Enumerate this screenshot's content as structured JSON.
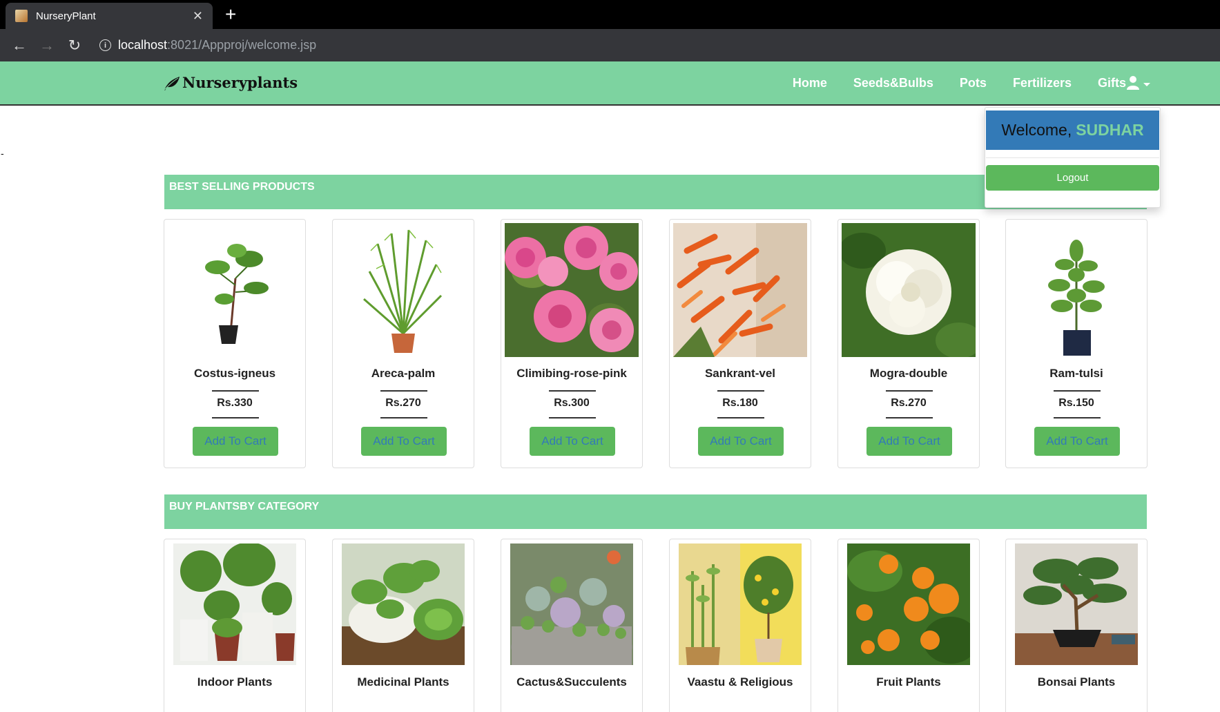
{
  "browser": {
    "tab_title": "NurseryPlant",
    "url_host": "localhost",
    "url_rest": ":8021/Appproj/welcome.jsp"
  },
  "site": {
    "brand": "Nurseryplants",
    "nav": [
      "Home",
      "Seeds&Bulbs",
      "Pots",
      "Fertilizers",
      "Gifts"
    ]
  },
  "user_menu": {
    "welcome_prefix": "Welcome,",
    "user_name": "SUDHAR",
    "logout": "Logout"
  },
  "stray_text": "-",
  "best_selling": {
    "title": "BEST SELLING PRODUCTS",
    "products": [
      {
        "name": "Costus-igneus",
        "price": "Rs.330",
        "button": "Add To Cart"
      },
      {
        "name": "Areca-palm",
        "price": "Rs.270",
        "button": "Add To Cart"
      },
      {
        "name": "Climibing-rose-pink",
        "price": "Rs.300",
        "button": "Add To Cart"
      },
      {
        "name": "Sankrant-vel",
        "price": "Rs.180",
        "button": "Add To Cart"
      },
      {
        "name": "Mogra-double",
        "price": "Rs.270",
        "button": "Add To Cart"
      },
      {
        "name": "Ram-tulsi",
        "price": "Rs.150",
        "button": "Add To Cart"
      }
    ]
  },
  "categories": {
    "title": "BUY PLANTSBY CATEGORY",
    "items": [
      {
        "name": "Indoor Plants"
      },
      {
        "name": "Medicinal Plants"
      },
      {
        "name": "Cactus&Succulents"
      },
      {
        "name": "Vaastu & Religious"
      },
      {
        "name": "Fruit Plants"
      },
      {
        "name": "Bonsai Plants"
      }
    ]
  },
  "colors": {
    "navbar_green": "#7dd3a0",
    "button_green": "#5cb85c",
    "welcome_blue": "#337ab7"
  }
}
